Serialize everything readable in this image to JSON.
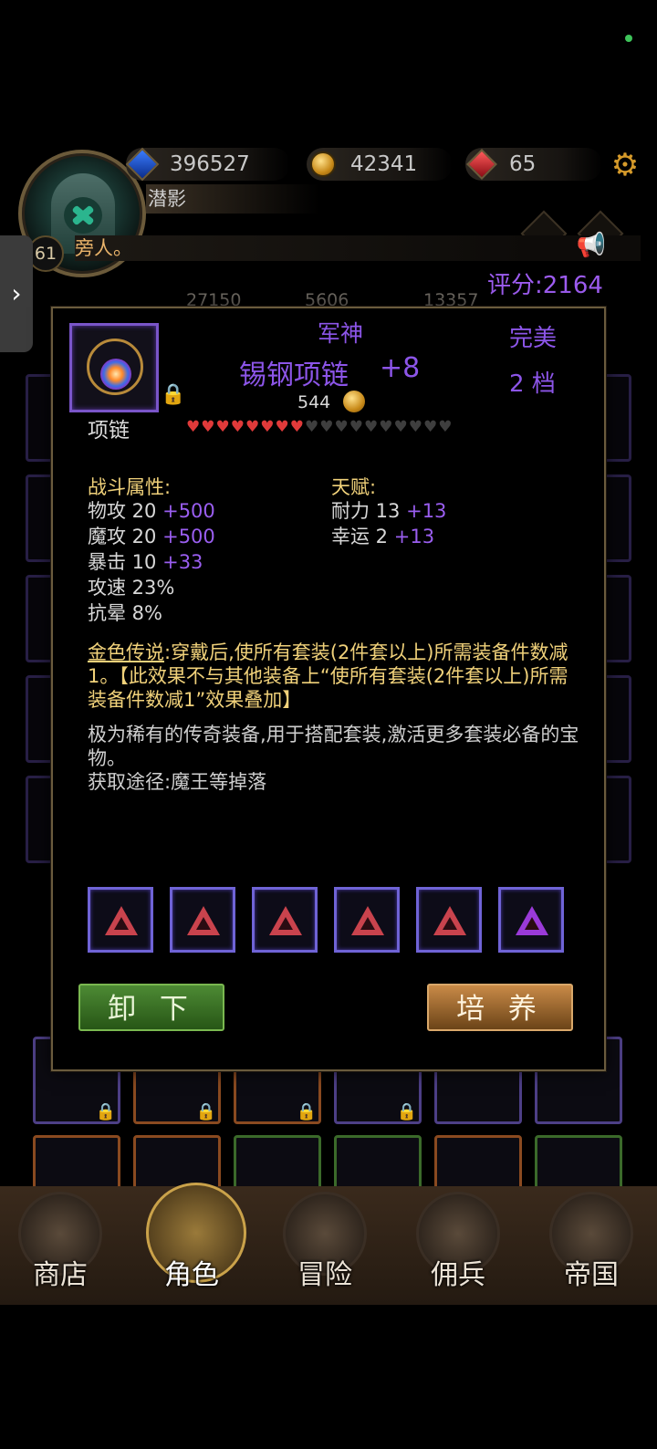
{
  "header": {
    "currency_blue": "396527",
    "currency_gold": "42341",
    "currency_red": "65",
    "player_name": "潜影",
    "level": "61",
    "motto": "旁人。",
    "score": "评分:2164",
    "peek_stats": [
      "27150",
      "5606",
      "13357"
    ]
  },
  "item": {
    "set_name": "军神",
    "name": "锡钢项链",
    "enhance": "+8",
    "price": "544",
    "quality": "完美",
    "grade": "2 档",
    "type": "项链",
    "hearts_filled": 8,
    "hearts_total": 18,
    "combat_title": "战斗属性:",
    "combat": [
      {
        "label": "物攻 20",
        "bonus": "+500"
      },
      {
        "label": "魔攻 20",
        "bonus": "+500"
      },
      {
        "label": "暴击 10",
        "bonus": "+33"
      },
      {
        "label": "攻速 23%",
        "bonus": ""
      },
      {
        "label": "抗晕 8%",
        "bonus": ""
      }
    ],
    "talent_title": "天赋:",
    "talent": [
      {
        "label": "耐力 13",
        "bonus": "+13"
      },
      {
        "label": "幸运 2",
        "bonus": "+13"
      }
    ],
    "legend_title": "金色传说",
    "legend_text": ":穿戴后,使所有套装(2件套以上)所需装备件数减1。【此效果不与其他装备上“使所有套装(2件套以上)所需装备件数减1”效果叠加】",
    "desc_1": "极为稀有的传奇装备,用于搭配套装,激活更多套装必备的宝物。",
    "desc_2": "获取途径:魔王等掉落",
    "gem_colors": [
      "red",
      "red",
      "red",
      "red",
      "red",
      "purple"
    ]
  },
  "buttons": {
    "unequip": "卸 下",
    "train": "培 养"
  },
  "nav": {
    "shop": "商店",
    "character": "角色",
    "adventure": "冒险",
    "mercenary": "佣兵",
    "empire": "帝国"
  }
}
